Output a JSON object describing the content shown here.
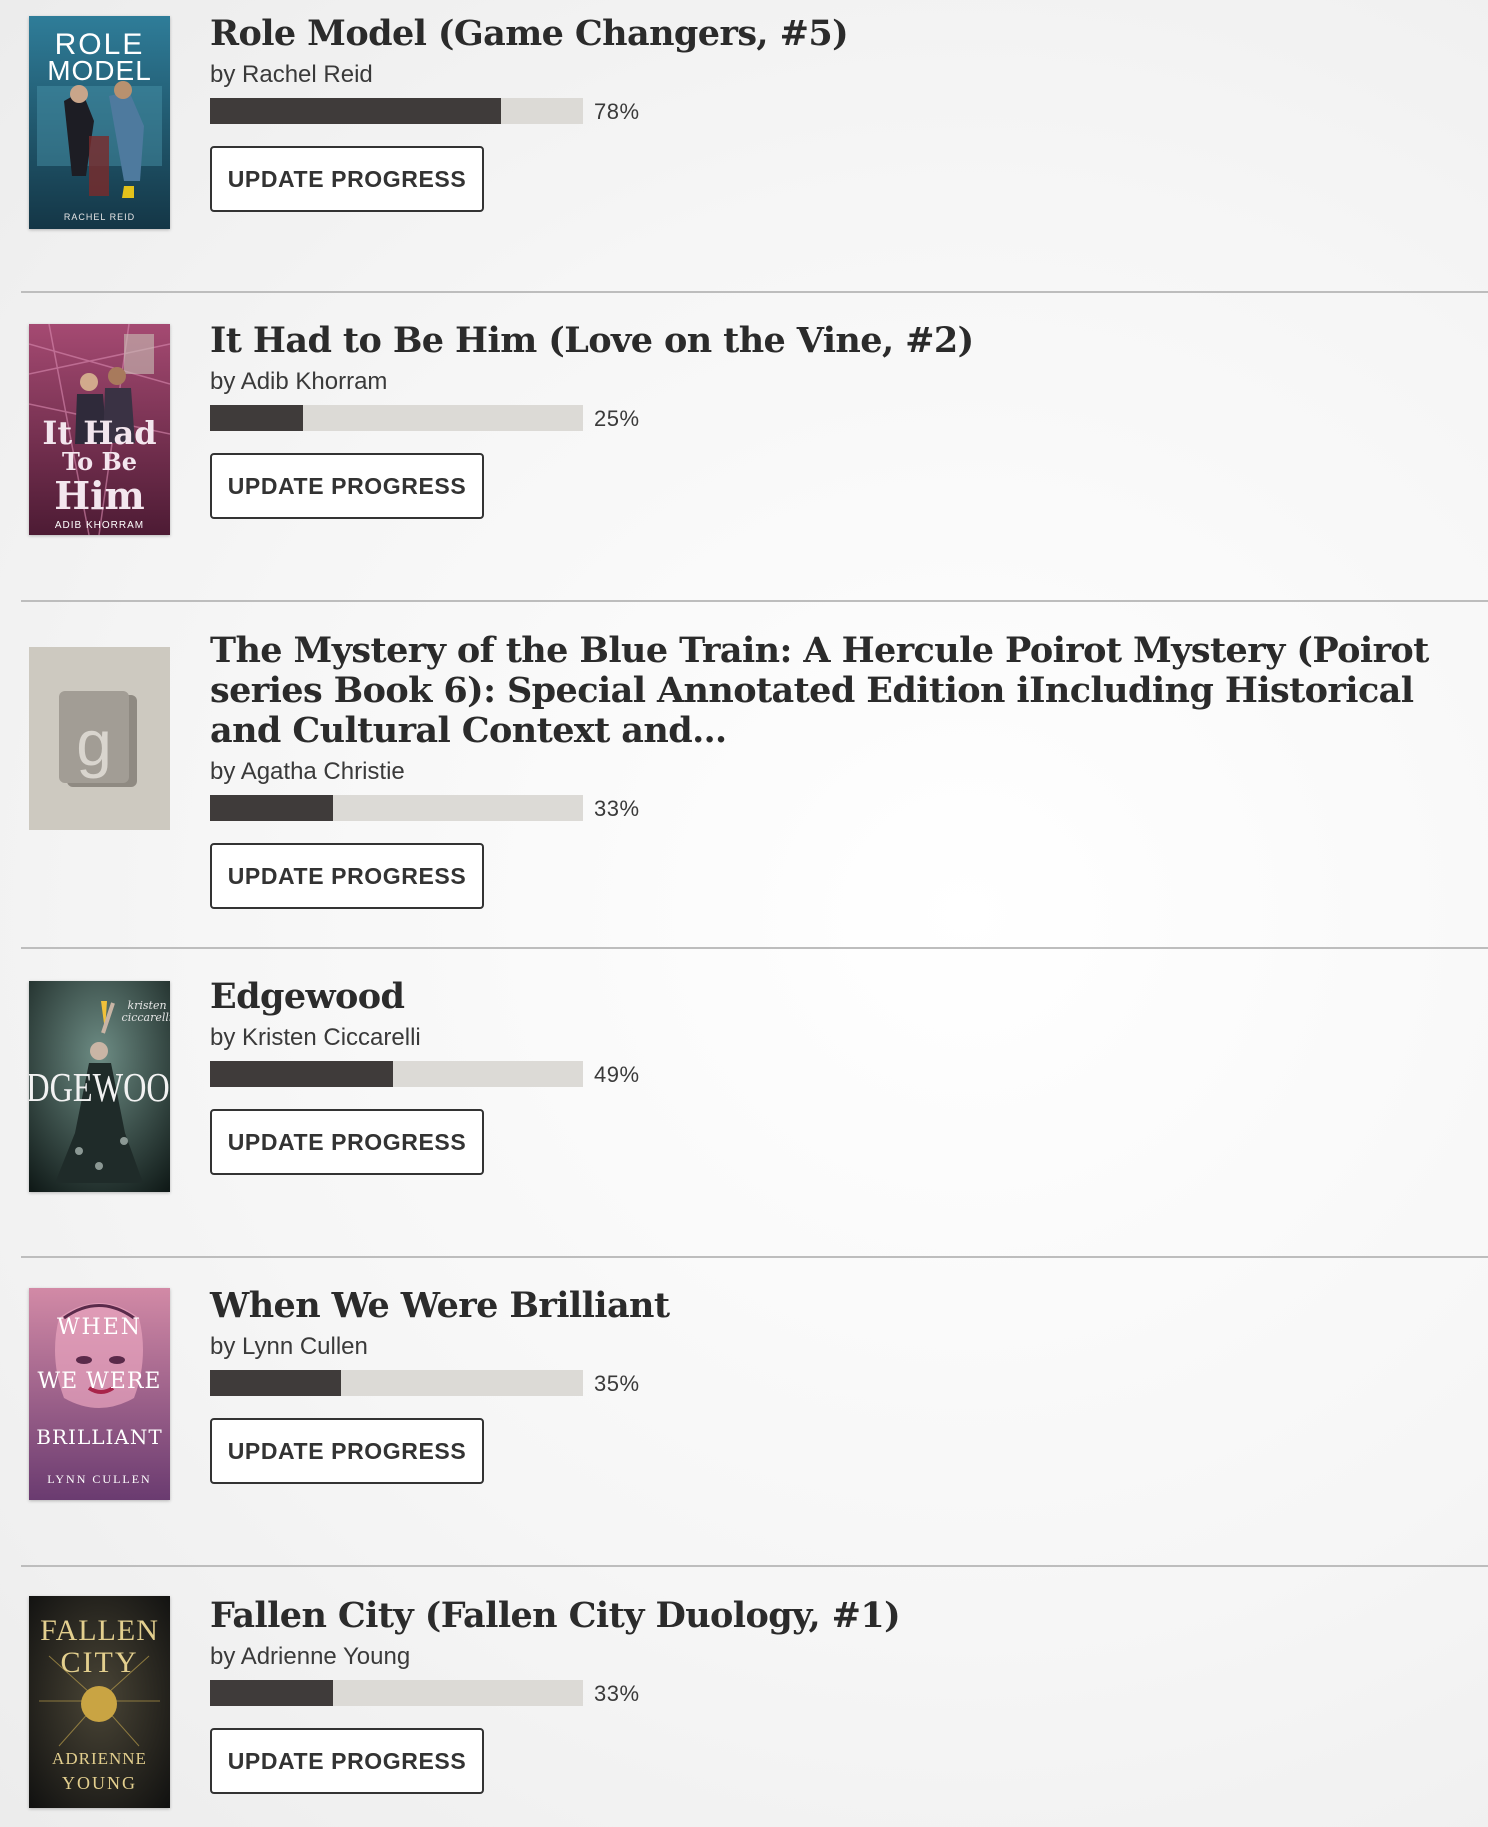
{
  "shelf": {
    "button_label": "UPDATE PROGRESS",
    "books": [
      {
        "title": "Role Model (Game Changers, #5)",
        "author": "by Rachel Reid",
        "progress_percent": 78,
        "progress_label": "78%",
        "cover": {
          "lines": [
            "ROLE",
            "MODEL"
          ],
          "footer": "RACHEL REID",
          "colors": [
            "#2a6f8a",
            "#163a4b"
          ]
        }
      },
      {
        "title": "It Had to Be Him (Love on the Vine, #2)",
        "author": "by Adib Khorram",
        "progress_percent": 25,
        "progress_label": "25%",
        "cover": {
          "lines": [
            "It Had",
            "To Be",
            "Him"
          ],
          "footer": "ADIB KHORRAM",
          "colors": [
            "#8a3a5e",
            "#5a1f3c"
          ]
        }
      },
      {
        "title": "The Mystery of the Blue Train: A Hercule Poirot Mystery (Poirot series Book 6): Special Annotated Edition iIncluding Historical and Cultural Context and…",
        "author": "by Agatha Christie",
        "progress_percent": 33,
        "progress_label": "33%",
        "cover": {
          "lines": [
            "g"
          ],
          "footer": "",
          "colors": [
            "#cfcbc3",
            "#cfcbc3"
          ]
        }
      },
      {
        "title": "Edgewood",
        "author": "by Kristen Ciccarelli",
        "progress_percent": 49,
        "progress_label": "49%",
        "cover": {
          "lines": [
            "EDGEWOOD"
          ],
          "footer": "",
          "subtitle": "kristen ciccarelli",
          "colors": [
            "#3e5a52",
            "#15201d"
          ]
        }
      },
      {
        "title": "When We Were Brilliant",
        "author": "by Lynn Cullen",
        "progress_percent": 35,
        "progress_label": "35%",
        "cover": {
          "lines": [
            "WHEN",
            "WE WERE",
            "BRILLIANT"
          ],
          "footer": "LYNN CULLEN",
          "colors": [
            "#c97a9a",
            "#5c3a6e"
          ]
        }
      },
      {
        "title": "Fallen City (Fallen City Duology, #1)",
        "author": "by Adrienne Young",
        "progress_percent": 33,
        "progress_label": "33%",
        "cover": {
          "lines": [
            "FALLEN",
            "CITY"
          ],
          "footer": "ADRIENNE YOUNG",
          "colors": [
            "#2a2a28",
            "#111110"
          ]
        }
      }
    ]
  }
}
